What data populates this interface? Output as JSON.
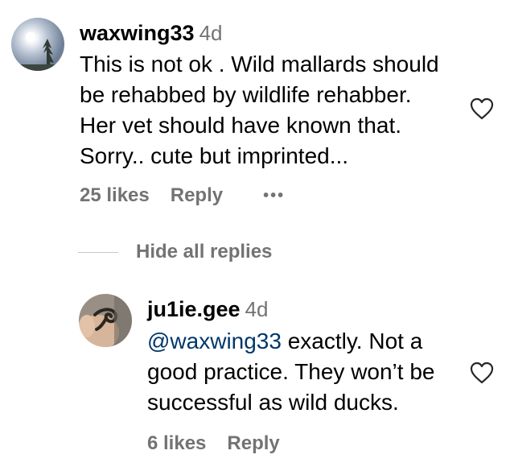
{
  "comments": [
    {
      "username": "waxwing33",
      "time": "4d",
      "text_lines": [
        "This is not ok . Wild mallards should",
        "be rehabbed by wildlife rehabber.",
        "Her vet should have known that.",
        "Sorry.. cute but imprinted..."
      ],
      "likes": "25 likes",
      "reply_label": "Reply",
      "more_label": "•••"
    }
  ],
  "hide_replies_label": "Hide all replies",
  "replies": [
    {
      "username": "ju1ie.gee",
      "time": "4d",
      "mention": "@waxwing33",
      "text_first_rest": " exactly. Not a",
      "text_lines": [
        "good practice. They won’t be",
        "successful as wild ducks."
      ],
      "likes": "6 likes",
      "reply_label": "Reply"
    }
  ],
  "colors": {
    "secondary_text": "#737373",
    "mention": "#00376b",
    "divider": "#c7c7c7"
  },
  "icons": {
    "like": "heart-outline-icon",
    "avatar1": "sky-tree-photo",
    "avatar2": "hand-holding-worm-photo"
  }
}
